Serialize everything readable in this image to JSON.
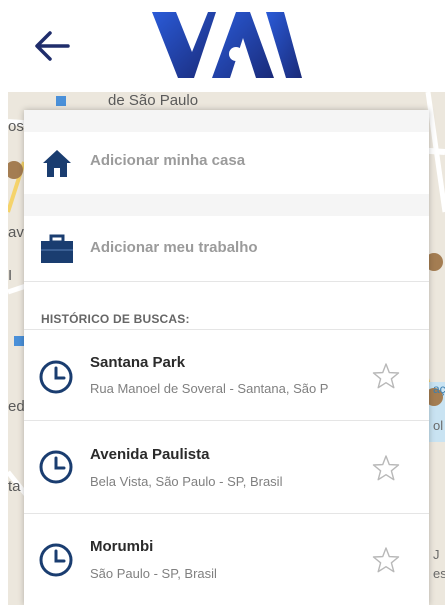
{
  "header": {
    "back_icon": "arrow-left-icon",
    "logo_name": "app-logo"
  },
  "map": {
    "labels": [
      "de São Paulo",
      "os",
      "av",
      "I",
      "ed",
      "ta",
      "J",
      "es",
      "ol",
      "açã"
    ]
  },
  "shortcuts": [
    {
      "label": "Adicionar minha casa",
      "icon": "home-icon"
    },
    {
      "label": "Adicionar meu trabalho",
      "icon": "briefcase-icon"
    }
  ],
  "history": {
    "heading": "HISTÓRICO DE BUSCAS:",
    "items": [
      {
        "title": "Santana Park",
        "subtitle": "Rua Manoel de Soveral - Santana, São P"
      },
      {
        "title": "Avenida Paulista",
        "subtitle": "Bela Vista, São Paulo - SP, Brasil"
      },
      {
        "title": "Morumbi",
        "subtitle": "São Paulo - SP, Brasil"
      }
    ]
  },
  "colors": {
    "brand": "#1f3aa6",
    "icon": "#1a3d70",
    "text": "#2b2b2b",
    "muted": "#9b9b9b"
  }
}
